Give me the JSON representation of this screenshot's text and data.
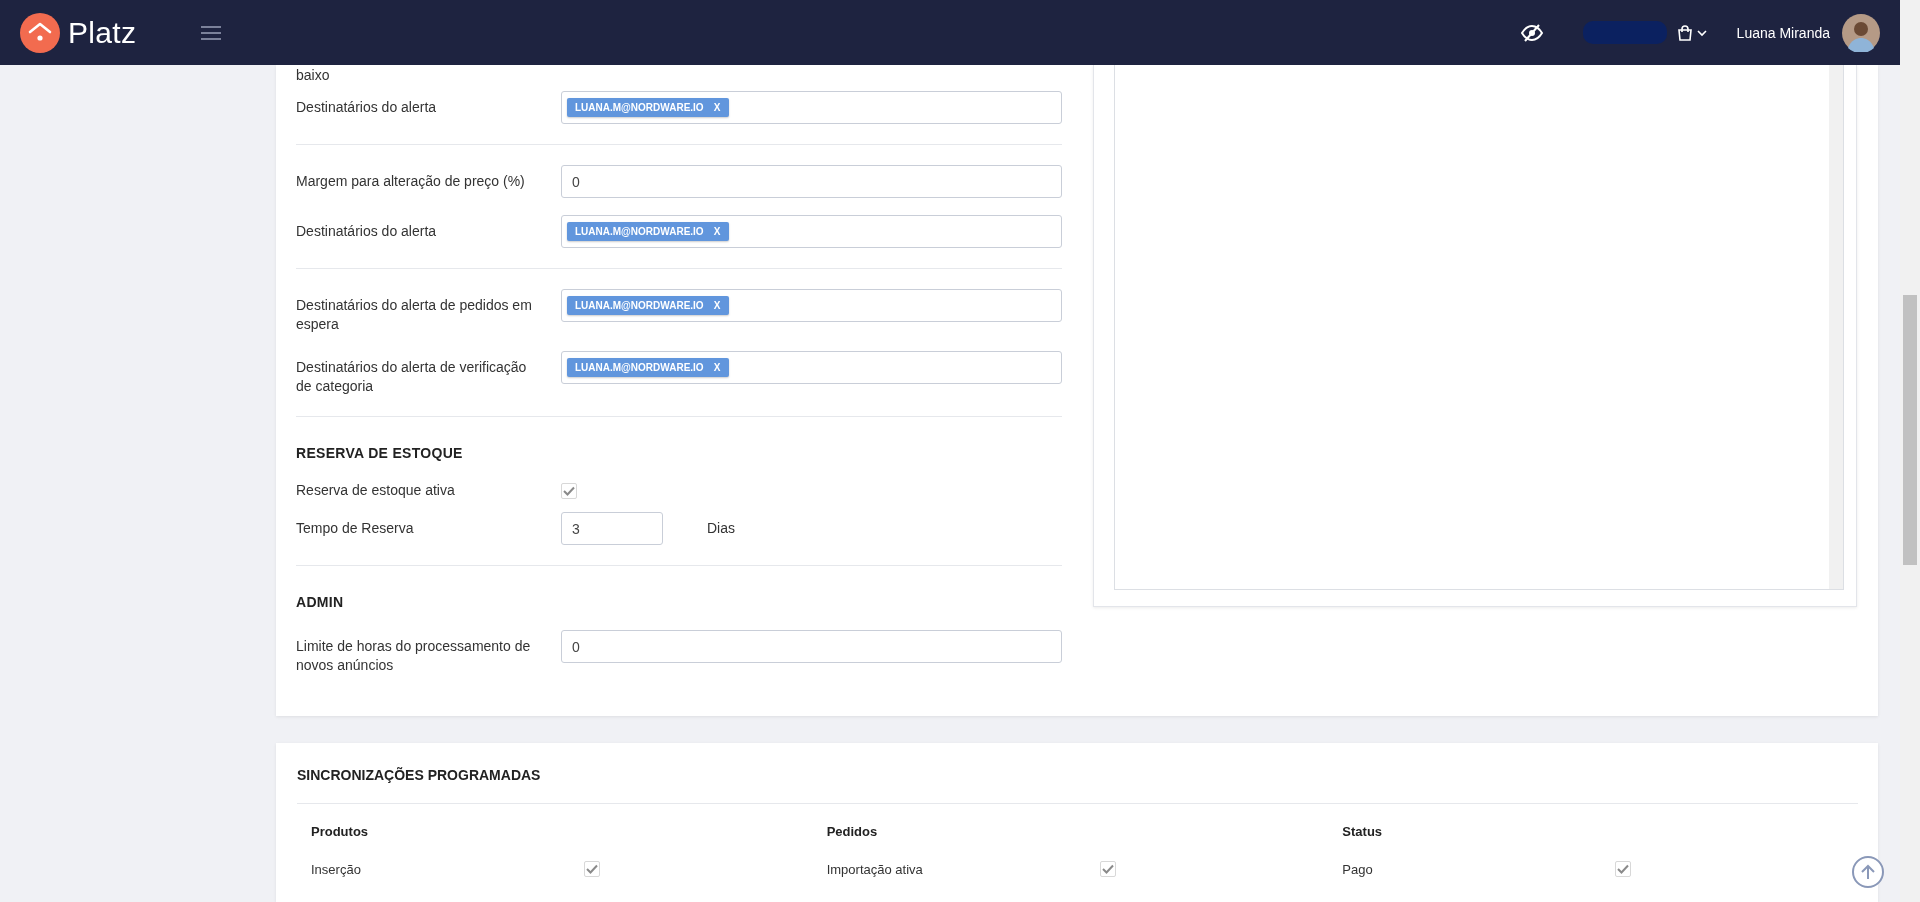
{
  "header": {
    "logo": "Platz",
    "user_name": "Luana Miranda"
  },
  "settings": {
    "items": [
      {
        "kind": "cut_label",
        "label": "baixo"
      },
      {
        "kind": "tags",
        "label": "Destinatários do alerta",
        "tags": [
          {
            "text": "LUANA.M@NORDWARE.IO",
            "remove": "X"
          }
        ]
      },
      {
        "kind": "divider"
      },
      {
        "kind": "input",
        "label": "Margem para alteração de preço (%)",
        "value": "0"
      },
      {
        "kind": "tags",
        "label": "Destinatários do alerta",
        "tags": [
          {
            "text": "LUANA.M@NORDWARE.IO",
            "remove": "X"
          }
        ]
      },
      {
        "kind": "divider"
      },
      {
        "kind": "tags",
        "label": "Destinatários do alerta de pedidos em espera",
        "tags": [
          {
            "text": "LUANA.M@NORDWARE.IO",
            "remove": "X"
          }
        ]
      },
      {
        "kind": "tags",
        "label": "Destinatários do alerta de verificação de categoria",
        "tags": [
          {
            "text": "LUANA.M@NORDWARE.IO",
            "remove": "X"
          }
        ]
      },
      {
        "kind": "divider"
      },
      {
        "kind": "heading",
        "label": "RESERVA DE ESTOQUE"
      },
      {
        "kind": "checkbox",
        "label": "Reserva de estoque ativa",
        "checked": true
      },
      {
        "kind": "unit_input",
        "label": "Tempo de Reserva",
        "value": "3",
        "unit": "Dias"
      },
      {
        "kind": "divider"
      },
      {
        "kind": "heading",
        "label": "ADMIN"
      },
      {
        "kind": "input",
        "label": "Limite de horas do processamento de novos anúncios",
        "value": "0"
      }
    ]
  },
  "sync": {
    "title": "SINCRONIZAÇÕES PROGRAMADAS",
    "columns": [
      {
        "heading": "Produtos",
        "items": [
          {
            "label": "Inserção",
            "checked": true
          }
        ]
      },
      {
        "heading": "Pedidos",
        "items": [
          {
            "label": "Importação ativa",
            "checked": true
          }
        ]
      },
      {
        "heading": "Status",
        "items": [
          {
            "label": "Pago",
            "checked": true
          }
        ]
      }
    ]
  }
}
